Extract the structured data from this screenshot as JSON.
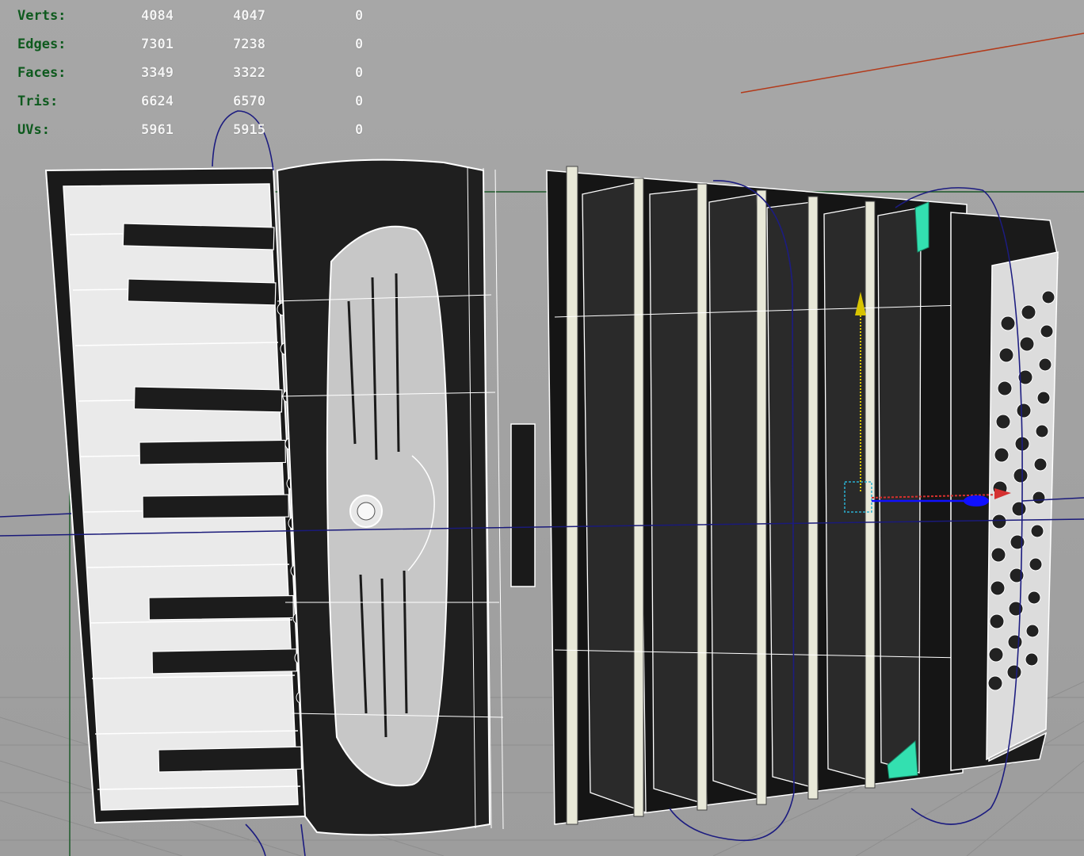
{
  "hud": {
    "rows": [
      {
        "label": "Verts:",
        "total": "4084",
        "selected": "4047",
        "extra": "0"
      },
      {
        "label": "Edges:",
        "total": "7301",
        "selected": "7238",
        "extra": "0"
      },
      {
        "label": "Faces:",
        "total": "3349",
        "selected": "3322",
        "extra": "0"
      },
      {
        "label": "Tris:",
        "total": "6624",
        "selected": "6570",
        "extra": "0"
      },
      {
        "label": "UVs:",
        "total": "5961",
        "selected": "5915",
        "extra": "0"
      }
    ]
  },
  "colors": {
    "viewport_bg": "#a3a3a3",
    "hud_label": "#0e5a1e",
    "hud_value": "#f4f4f4",
    "wireframe": "#ffffff",
    "body_dark": "#1c1c1c",
    "key_white": "#f2f2f2",
    "horizon_line": "#1a1a7a",
    "x_axis": "#b33a1a",
    "y_axis": "#c8b400",
    "z_axis": "#1010ff",
    "selection_cyan": "#33e0b0"
  }
}
